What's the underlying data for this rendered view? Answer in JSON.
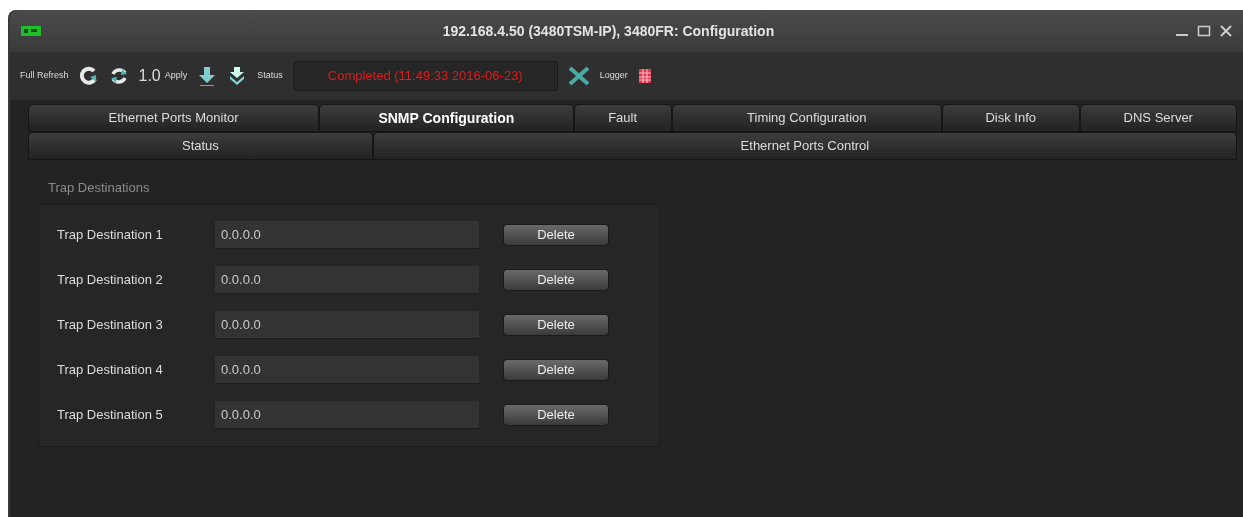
{
  "window": {
    "title": "192.168.4.50 (3480TSM-IP), 3480FR: Configuration"
  },
  "toolbar": {
    "full_refresh": "Full Refresh",
    "interval": "1.0",
    "apply": "Apply",
    "status_label": "Status",
    "status": "Completed  (11:49:33  2016-06-23)",
    "logger": "Logger"
  },
  "tab_rows": [
    [
      {
        "label": "Ethernet Ports Monitor",
        "selected": false
      },
      {
        "label": "SNMP Configuration",
        "selected": true
      },
      {
        "label": "Fault",
        "selected": false
      },
      {
        "label": "Timing Configuration",
        "selected": false
      },
      {
        "label": "Disk Info",
        "selected": false
      },
      {
        "label": "DNS Server",
        "selected": false
      }
    ],
    [
      {
        "label": "Status",
        "selected": false
      },
      {
        "label": "Ethernet Ports Control",
        "selected": false
      }
    ]
  ],
  "trap_destinations": {
    "title": "Trap Destinations",
    "rows": [
      {
        "label": "Trap Destination 1",
        "value": "0.0.0.0",
        "button": "Delete"
      },
      {
        "label": "Trap Destination 2",
        "value": "0.0.0.0",
        "button": "Delete"
      },
      {
        "label": "Trap Destination 3",
        "value": "0.0.0.0",
        "button": "Delete"
      },
      {
        "label": "Trap Destination 4",
        "value": "0.0.0.0",
        "button": "Delete"
      },
      {
        "label": "Trap Destination 5",
        "value": "0.0.0.0",
        "button": "Delete"
      }
    ]
  }
}
